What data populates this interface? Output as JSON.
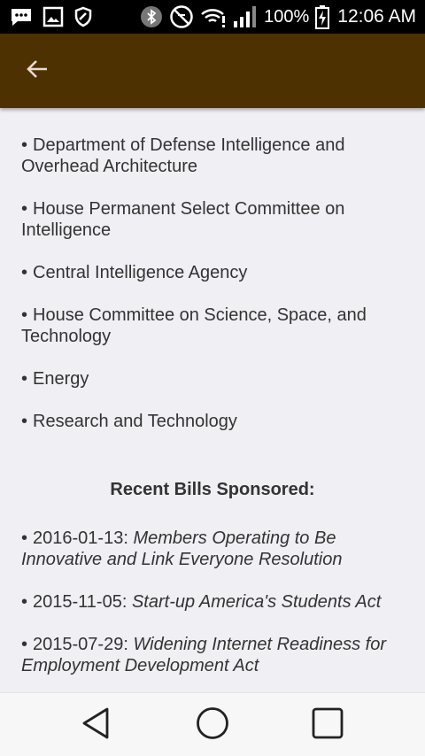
{
  "status_bar": {
    "battery_percent": "100%",
    "time": "12:06 AM",
    "icons": [
      "message-icon",
      "image-icon",
      "shield-icon",
      "bluetooth-icon",
      "do-not-disturb-icon",
      "wifi-icon",
      "signal-icon",
      "battery-charging-icon"
    ]
  },
  "app_bar": {
    "back_icon": "arrow-left-icon",
    "color": "#4d3100"
  },
  "committees": {
    "cut_off_text": "(partially hidden line)",
    "items": [
      {
        "label": "Department of Defense Intelligence and Overhead Architecture"
      },
      {
        "label": "House Permanent Select Committee on Intelligence"
      },
      {
        "label": "Central Intelligence Agency"
      },
      {
        "label": "House Committee on Science, Space, and Technology"
      },
      {
        "label": "Energy"
      },
      {
        "label": "Research and Technology"
      }
    ]
  },
  "bills": {
    "heading": "Recent Bills Sponsored:",
    "items": [
      {
        "date": "2016-01-13:",
        "title": "Members Operating to Be Innovative and Link Everyone Resolution"
      },
      {
        "date": "2015-11-05:",
        "title": "Start-up America's Students Act"
      },
      {
        "date": "2015-07-29:",
        "title": "Widening Internet Readiness for Employment Development Act"
      }
    ]
  },
  "nav": {
    "back_icon": "triangle-back-icon",
    "home_icon": "circle-home-icon",
    "recents_icon": "square-recents-icon"
  }
}
